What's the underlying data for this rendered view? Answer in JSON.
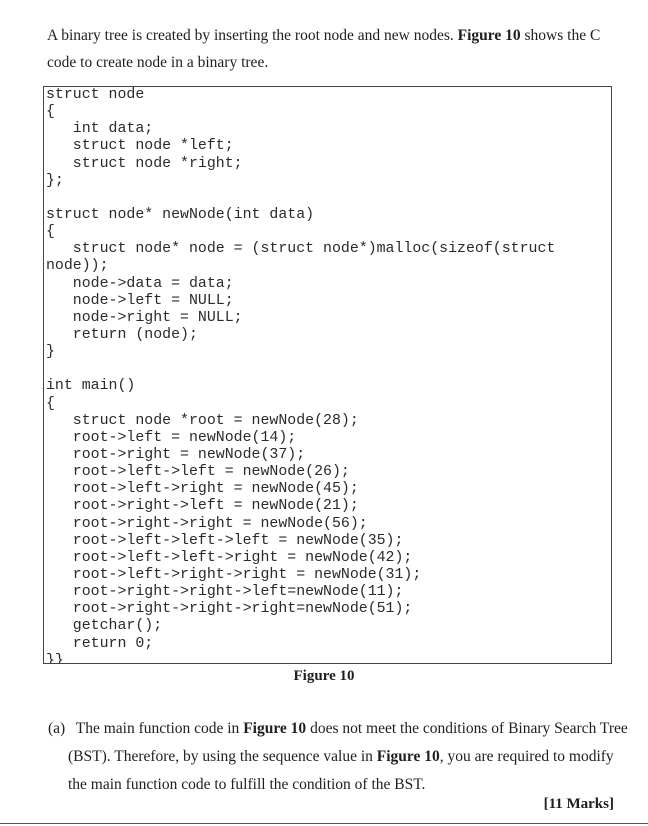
{
  "intro": {
    "text_before": "A binary tree is created by inserting the root node and new nodes. ",
    "figure_ref": "Figure 10",
    "text_after": " shows the C code to create node in a binary tree."
  },
  "code_lines": [
    "struct node",
    "{",
    "   int data;",
    "   struct node *left;",
    "   struct node *right;",
    "};",
    "",
    "struct node* newNode(int data)",
    "{",
    "   struct node* node = (struct node*)malloc(sizeof(struct",
    "node));",
    "   node->data = data;",
    "   node->left = NULL;",
    "   node->right = NULL;",
    "   return (node);",
    "}",
    "",
    "int main()",
    "{",
    "   struct node *root = newNode(28);",
    "   root->left = newNode(14);",
    "   root->right = newNode(37);",
    "   root->left->left = newNode(26);",
    "   root->left->right = newNode(45);",
    "   root->right->left = newNode(21);",
    "   root->right->right = newNode(56);",
    "   root->left->left->left = newNode(35);",
    "   root->left->left->right = newNode(42);",
    "   root->left->right->right = newNode(31);",
    "   root->right->right->left=newNode(11);",
    "   root->right->right->right=newNode(51);",
    "   getchar();",
    "   return 0;",
    "}}"
  ],
  "caption": "Figure 10",
  "question": {
    "label": "(a)",
    "part1": "The main function code in ",
    "ref1": "Figure 10",
    "part2": " does not meet the conditions of Binary Search Tree (BST). Therefore, by using the sequence value in ",
    "ref2": "Figure 10",
    "part3": ", you are required to modify the main function code to fulfill the condition of the BST."
  },
  "marks": "[11 Marks]"
}
